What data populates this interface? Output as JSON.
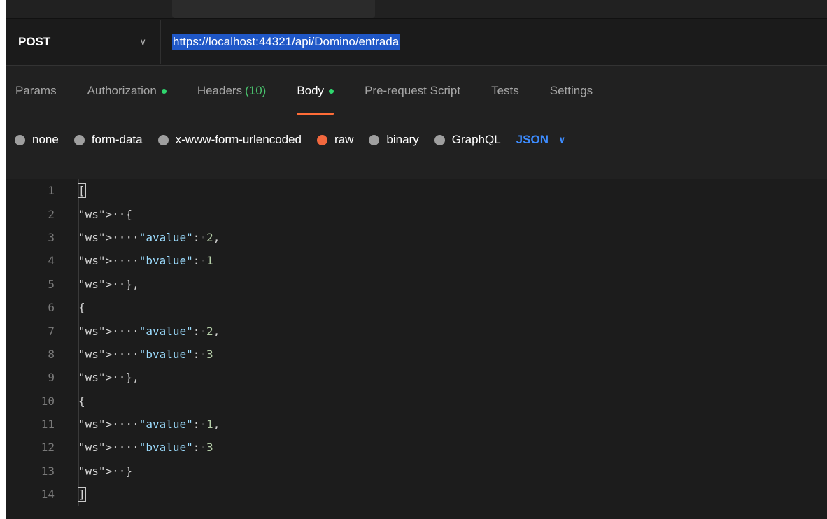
{
  "request": {
    "method": "POST",
    "url": "https://localhost:44321/api/Domino/entrada"
  },
  "tabs": [
    {
      "label": "Params"
    },
    {
      "label": "Authorization"
    },
    {
      "label": "Headers",
      "count": "(10)"
    },
    {
      "label": "Body"
    },
    {
      "label": "Pre-request Script"
    },
    {
      "label": "Tests"
    },
    {
      "label": "Settings"
    }
  ],
  "body_modes": [
    {
      "label": "none"
    },
    {
      "label": "form-data"
    },
    {
      "label": "x-www-form-urlencoded"
    },
    {
      "label": "raw"
    },
    {
      "label": "binary"
    },
    {
      "label": "GraphQL"
    }
  ],
  "format": "JSON",
  "editor": {
    "line_numbers": [
      "1",
      "2",
      "3",
      "4",
      "5",
      "6",
      "7",
      "8",
      "9",
      "10",
      "11",
      "12",
      "13",
      "14"
    ],
    "lines": [
      "[",
      "  {",
      "    \"avalue\": 2,",
      "    \"bvalue\": 1",
      "  },",
      "{",
      "    \"avalue\": 2,",
      "    \"bvalue\": 3",
      "  },",
      "{",
      "    \"avalue\": 1,",
      "    \"bvalue\": 3",
      "  }",
      "]"
    ]
  },
  "colors": {
    "accent": "#ff6c37",
    "active_dot": "#2fd66e",
    "url_highlight": "#1f57c7",
    "format_blue": "#3d8cff"
  }
}
